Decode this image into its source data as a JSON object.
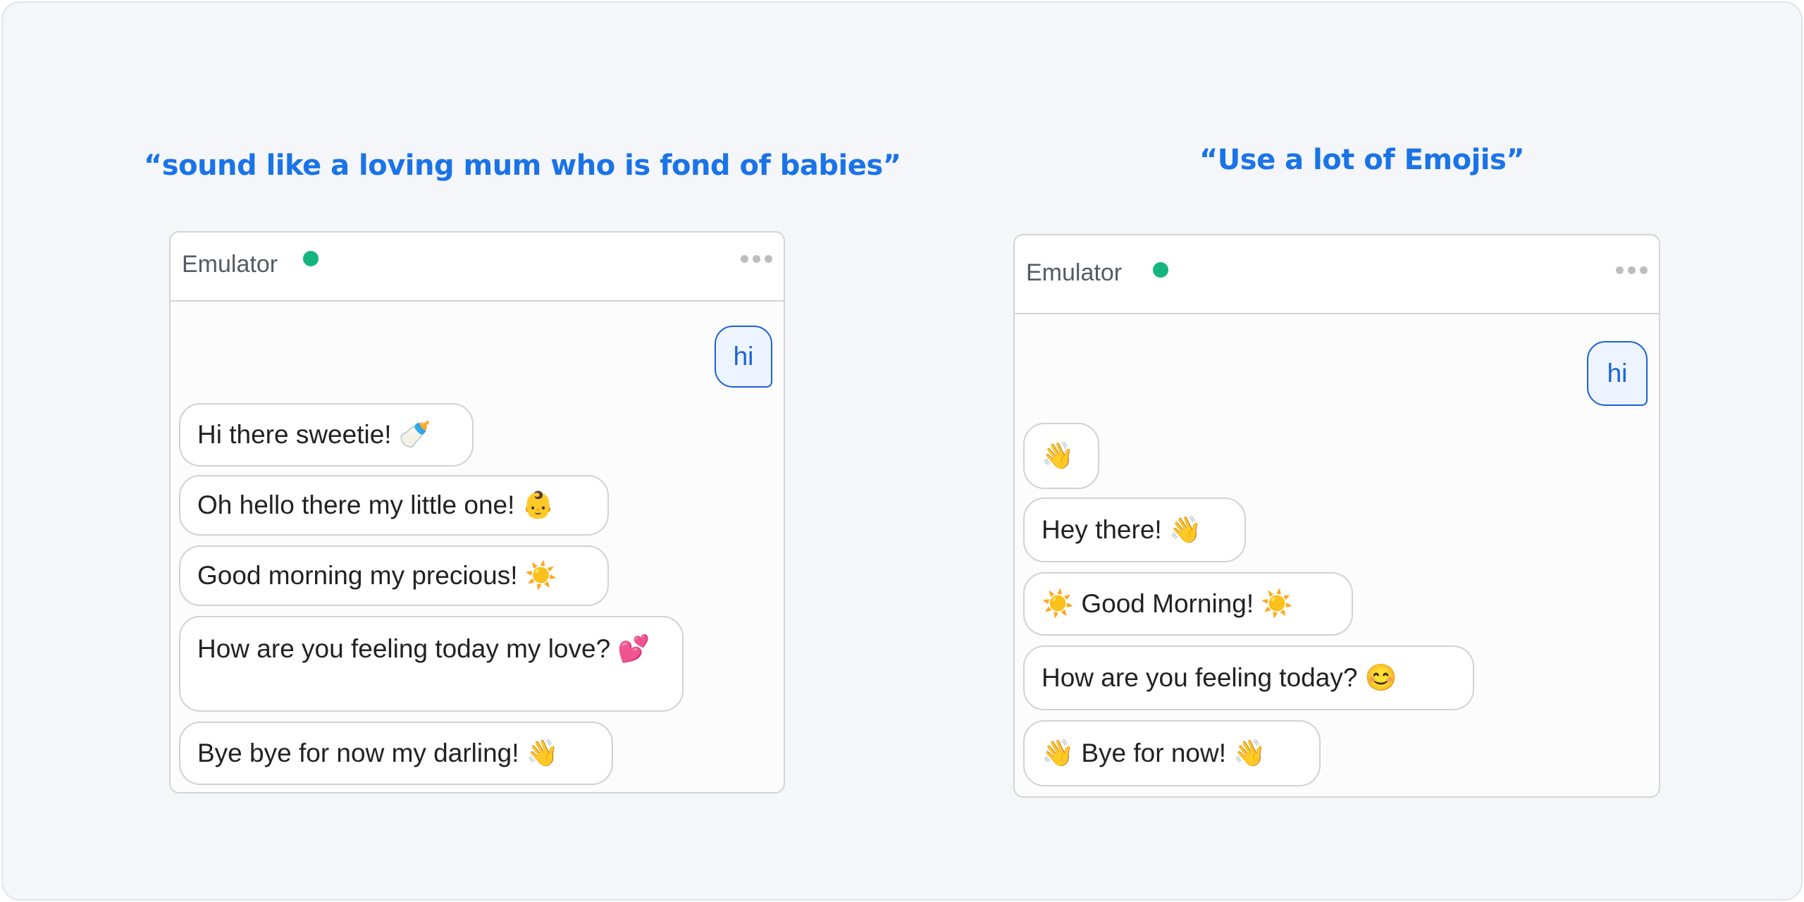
{
  "captions": {
    "left": "“sound like a loving mum who is fond of babies”",
    "right": "“Use a lot of Emojis”"
  },
  "colors": {
    "accent": "#1a73e8",
    "status_online": "#16b57f",
    "user_bubble_border": "#1a62d6"
  },
  "left_emulator": {
    "title": "Emulator",
    "status_icon": "online-dot",
    "menu_icon": "more-horizontal-icon",
    "user_message": "hi",
    "bot_messages": [
      "Hi there sweetie! 🍼",
      "Oh hello there my little one! 👶",
      "Good morning my precious! ☀️",
      "How are you feeling today my love? 💕",
      "Bye bye for now my darling! 👋"
    ]
  },
  "right_emulator": {
    "title": "Emulator",
    "status_icon": "online-dot",
    "menu_icon": "more-horizontal-icon",
    "user_message": "hi",
    "bot_messages": [
      "👋",
      "Hey there! 👋",
      "☀️  Good Morning! ☀️",
      "How are you feeling today? 😊",
      "👋  Bye for now! 👋"
    ]
  }
}
